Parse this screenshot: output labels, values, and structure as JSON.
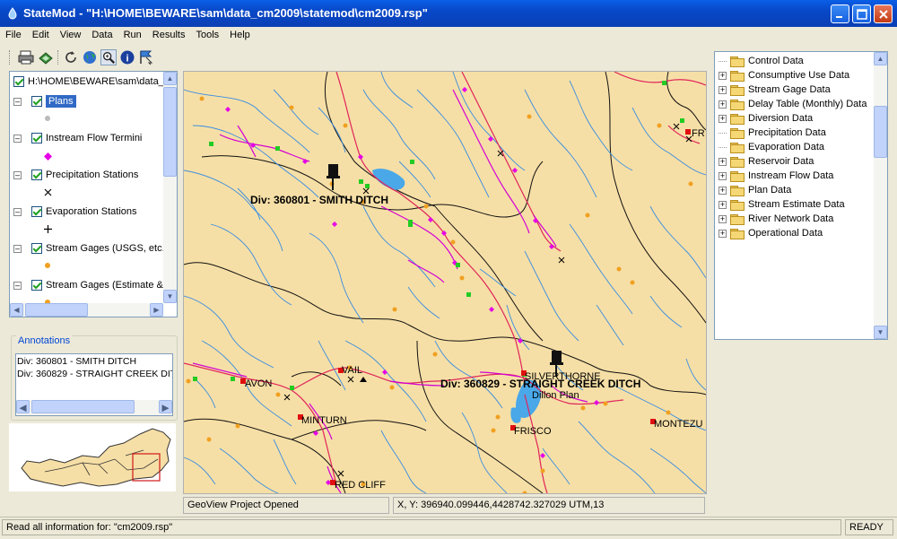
{
  "window": {
    "title": "StateMod - \"H:\\HOME\\BEWARE\\sam\\data_cm2009\\statemod\\cm2009.rsp\""
  },
  "menu": [
    "File",
    "Edit",
    "View",
    "Data",
    "Run",
    "Results",
    "Tools",
    "Help"
  ],
  "layers": {
    "root_label": "H:\\HOME\\BEWARE\\sam\\data_c",
    "items": [
      {
        "label": "Plans",
        "selected": true
      },
      {
        "label": "Instream Flow Termini"
      },
      {
        "label": "Precipitation Stations"
      },
      {
        "label": "Evaporation Stations"
      },
      {
        "label": "Stream Gages (USGS, etc."
      },
      {
        "label": "Stream Gages (Estimate &"
      }
    ]
  },
  "annotations": {
    "title": "Annotations",
    "items": [
      "Div: 360801 - SMITH DITCH",
      "Div: 360829 - STRAIGHT CREEK DIT"
    ]
  },
  "map": {
    "labels": {
      "div1": "Div: 360801 - SMITH DITCH",
      "div2": "Div: 360829 - STRAIGHT CREEK DITCH",
      "vail": "VAIL",
      "avon": "AVON",
      "minturn": "MINTURN",
      "silverthorne": "SILVERTHORNE",
      "dillon": "Dillon Plan",
      "frisco": "FRISCO",
      "montezuma": "MONTEZU",
      "redcliff": "RED CLIFF",
      "fr": "FR"
    }
  },
  "map_status": {
    "message": "GeoView Project Opened",
    "coords": "X, Y:  396940.099446,4428742.327029 UTM,13"
  },
  "data_tree": [
    {
      "label": "Control Data",
      "expandable": false
    },
    {
      "label": "Consumptive Use Data",
      "expandable": true
    },
    {
      "label": "Stream Gage Data",
      "expandable": true
    },
    {
      "label": "Delay Table (Monthly) Data",
      "expandable": true
    },
    {
      "label": "Diversion Data",
      "expandable": true
    },
    {
      "label": "Precipitation Data",
      "expandable": false
    },
    {
      "label": "Evaporation Data",
      "expandable": false
    },
    {
      "label": "Reservoir Data",
      "expandable": true
    },
    {
      "label": "Instream Flow Data",
      "expandable": true
    },
    {
      "label": "Plan Data",
      "expandable": true
    },
    {
      "label": "Stream Estimate Data",
      "expandable": true
    },
    {
      "label": "River Network Data",
      "expandable": true
    },
    {
      "label": "Operational Data",
      "expandable": true
    }
  ],
  "status": {
    "message": "Read all information for: \"cm2009.rsp\"",
    "state": "READY"
  },
  "colors": {
    "titlebar": "#0a5fe6",
    "map_background": "#f6dfa6",
    "river": "#3a8de0",
    "main_river": "#e0245a",
    "canal": "#d400d4",
    "selection": "#316ac5"
  }
}
